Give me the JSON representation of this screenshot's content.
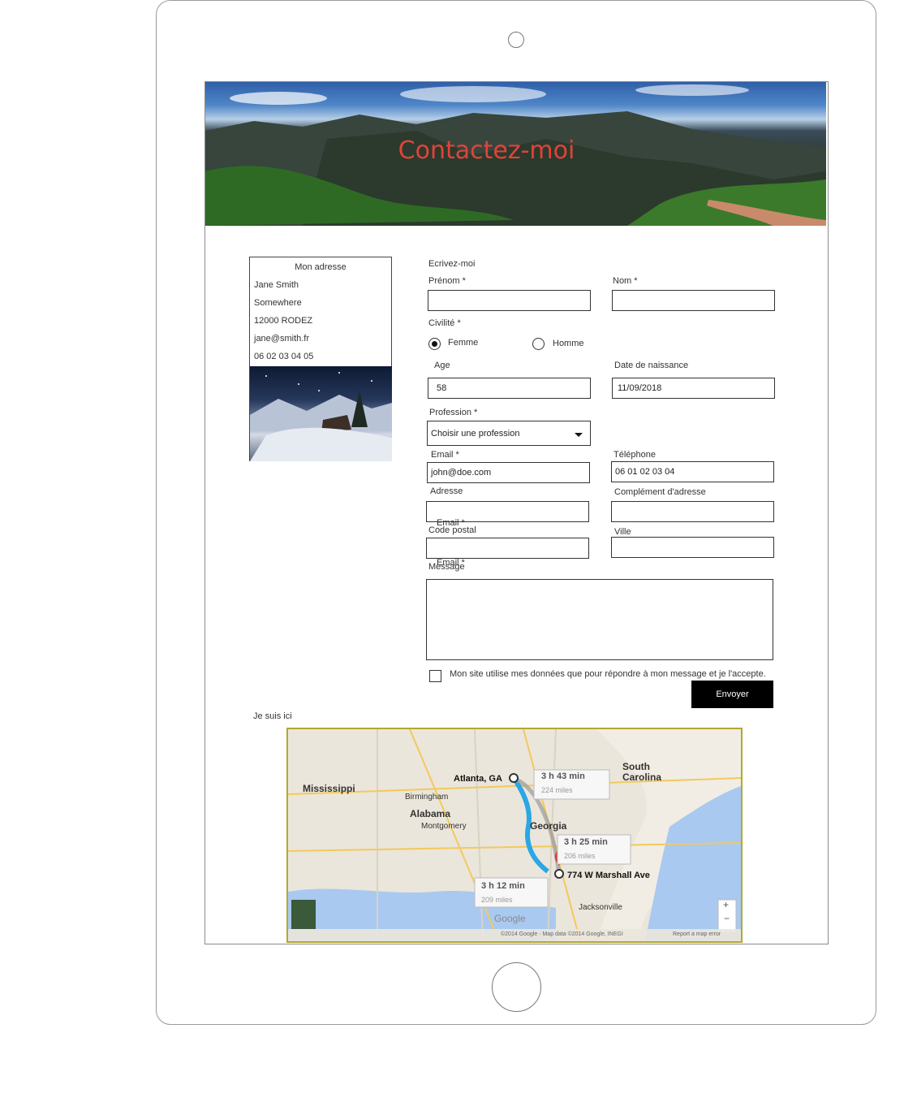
{
  "banner": {
    "title": "Contactez-moi"
  },
  "address_card": {
    "heading": "Mon adresse",
    "lines": [
      "Jane Smith",
      "Somewhere",
      "12000 RODEZ",
      "jane@smith.fr",
      "06 02 03 04 05"
    ]
  },
  "form": {
    "heading": "Ecrivez-moi",
    "firstname_label": "Prénom *",
    "lastname_label": "Nom *",
    "civility_label": "Civilité *",
    "civility_options": [
      "Femme",
      "Homme"
    ],
    "civility_selected": "Femme",
    "age_label": "Age",
    "age_value": "58",
    "birthdate_label": "Date de naissance",
    "birthdate_value": "11/09/2018",
    "profession_label": "Profession *",
    "profession_value": "Choisir une profession",
    "email_label": "Email *",
    "email_value": "john@doe.com",
    "phone_label": "Téléphone",
    "phone_value": "06 01 02 03 04",
    "address_label": "Adresse",
    "address2_label": "Complément d'adresse",
    "ghost_label_1": "Email *",
    "postal_label": "Code postal",
    "city_label": "Ville",
    "ghost_label_2": "Email *",
    "message_label": "Message",
    "consent_text": "Mon site utilise mes données que pour répondre à mon message et je l'accepte.",
    "submit_label": "Envoyer"
  },
  "map_section": {
    "label": "Je suis ici",
    "places": {
      "mississippi": "Mississippi",
      "alabama": "Alabama",
      "georgia": "Georgia",
      "south_carolina": "South Carolina",
      "atlanta": "Atlanta, GA",
      "birmingham": "Birmingham",
      "montgomery": "Montgomery",
      "jacksonville": "Jacksonville",
      "destination": "774 W Marshall Ave"
    },
    "routes": [
      {
        "time": "3 h 43 min",
        "distance": "224 miles"
      },
      {
        "time": "3 h 25 min",
        "distance": "206 miles"
      },
      {
        "time": "3 h 12 min",
        "distance": "209 miles"
      }
    ],
    "copyright": "©2014 Google · Map data ©2014 Google, INEGI",
    "report": "Report a map error",
    "brand": "Google",
    "zoom_in": "+",
    "zoom_out": "−"
  }
}
